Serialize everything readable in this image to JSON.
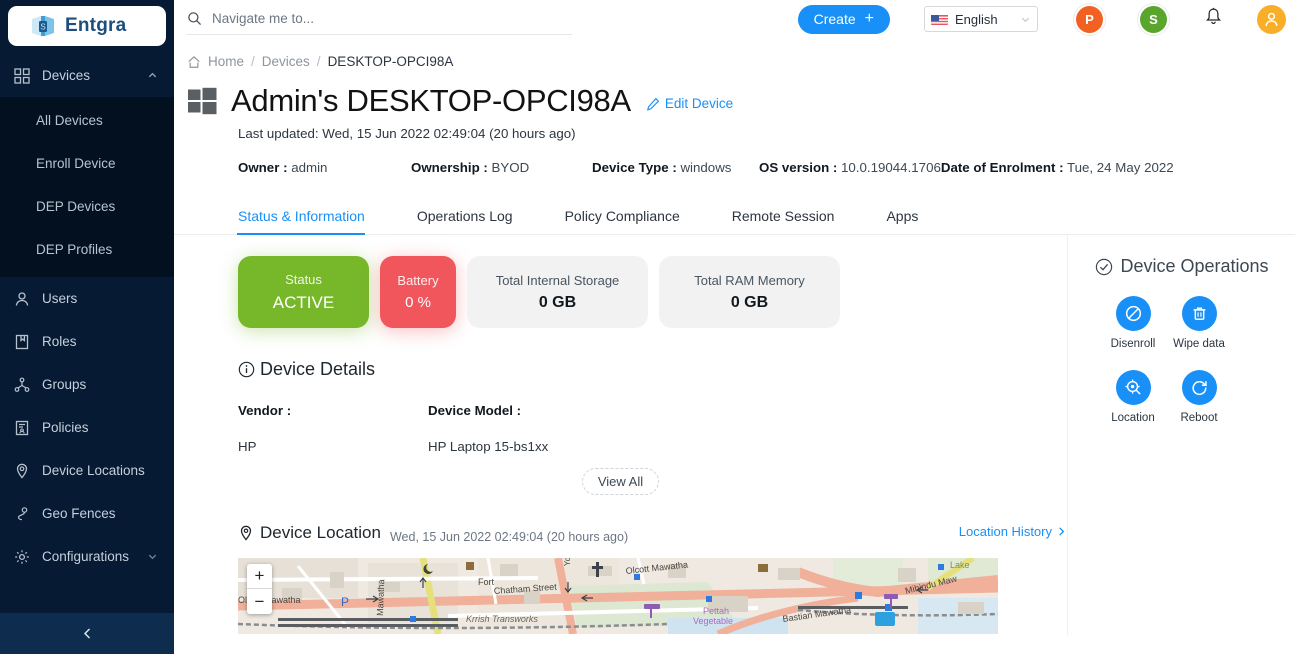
{
  "brand": {
    "name": "Entgra",
    "logo_icon": "entgra-cube-icon"
  },
  "sidebar": {
    "active_group": "Devices",
    "items": [
      {
        "label": "Devices",
        "icon": "grid-icon",
        "expanded": true,
        "chevron": "chevron-up-icon"
      },
      {
        "label": "Users",
        "icon": "user-icon"
      },
      {
        "label": "Roles",
        "icon": "book-icon"
      },
      {
        "label": "Groups",
        "icon": "group-icon"
      },
      {
        "label": "Policies",
        "icon": "policy-icon"
      },
      {
        "label": "Device Locations",
        "icon": "map-pin-icon"
      },
      {
        "label": "Geo Fences",
        "icon": "geofence-icon"
      },
      {
        "label": "Configurations",
        "icon": "gear-icon",
        "chevron": "chevron-down-icon"
      }
    ],
    "sub_items": [
      {
        "label": "All Devices"
      },
      {
        "label": "Enroll Device"
      },
      {
        "label": "DEP Devices"
      },
      {
        "label": "DEP Profiles"
      }
    ],
    "collapse_icon": "chevron-left-icon"
  },
  "header": {
    "search": {
      "placeholder": "Navigate me to...",
      "value": "",
      "icon": "search-icon"
    },
    "create_label": "Create",
    "create_plus": "+",
    "language": {
      "value": "English",
      "flag": "us-flag-icon",
      "chevron": "chevron-down-icon"
    },
    "badges": [
      {
        "letter": "P",
        "color": "#f26122"
      },
      {
        "letter": "S",
        "color": "#5aa52b"
      }
    ],
    "bell_icon": "bell-icon",
    "avatar_icon": "user-avatar-icon",
    "avatar_color": "#f8af27"
  },
  "breadcrumb": {
    "home": "Home",
    "devices": "Devices",
    "current": "DESKTOP-OPCI98A",
    "home_icon": "home-icon",
    "sep": "/"
  },
  "device": {
    "title": "Admin's DESKTOP-OPCI98A",
    "platform_icon": "windows-icon",
    "edit_label": "Edit Device",
    "edit_icon": "pencil-icon",
    "last_updated": "Last updated: Wed, 15 Jun 2022 02:49:04 (20 hours ago)",
    "meta": [
      {
        "key": "Owner :",
        "value": "admin"
      },
      {
        "key": "Ownership :",
        "value": "BYOD"
      },
      {
        "key": "Device Type :",
        "value": "windows"
      },
      {
        "key": "OS version :",
        "value": "10.0.19044.1706"
      },
      {
        "key": "Date of Enrolment :",
        "value": "Tue, 24 May 2022"
      }
    ]
  },
  "tabs": [
    {
      "label": "Status & Information",
      "active": true
    },
    {
      "label": "Operations Log",
      "active": false
    },
    {
      "label": "Policy Compliance",
      "active": false
    },
    {
      "label": "Remote Session",
      "active": false
    },
    {
      "label": "Apps",
      "active": false
    }
  ],
  "status_cards": [
    {
      "label": "Status",
      "value": "ACTIVE",
      "style": "status",
      "color": "#76b82a"
    },
    {
      "label": "Battery",
      "value": "0 %",
      "style": "battery",
      "color": "#f0565b"
    },
    {
      "label": "Total Internal Storage",
      "value": "0 GB",
      "style": "plain"
    },
    {
      "label": "Total RAM Memory",
      "value": "0 GB",
      "style": "plain"
    }
  ],
  "device_details": {
    "heading": "Device Details",
    "icon": "info-icon",
    "fields": [
      {
        "key": "Vendor :",
        "value": "HP"
      },
      {
        "key": "Device Model :",
        "value": "HP Laptop 15-bs1xx"
      }
    ],
    "view_all": "View All"
  },
  "device_location": {
    "heading": "Device Location",
    "icon": "map-pin-icon",
    "timestamp": "Wed, 15 Jun 2022 02:49:04 (20 hours ago)",
    "history_link": "Location History",
    "history_chevron": "chevron-right-icon",
    "zoom_in": "+",
    "zoom_out": "−",
    "map_labels": [
      "Fort",
      "Chatham Street",
      "Krrish Transworks",
      "Mawatha",
      "Olcott Mawatha",
      "Pettah",
      "Vegetable",
      "Bastian Mawatha",
      "Mihindu Maw",
      "Lake",
      "P"
    ]
  },
  "device_operations": {
    "heading": "Device Operations",
    "icon": "check-circle-icon",
    "accent": "#1890f7",
    "items": [
      {
        "label": "Disenroll",
        "icon": "ban-icon"
      },
      {
        "label": "Wipe data",
        "icon": "trash-icon"
      },
      {
        "label": "Location",
        "icon": "location-scan-icon"
      },
      {
        "label": "Reboot",
        "icon": "reboot-icon"
      }
    ]
  }
}
